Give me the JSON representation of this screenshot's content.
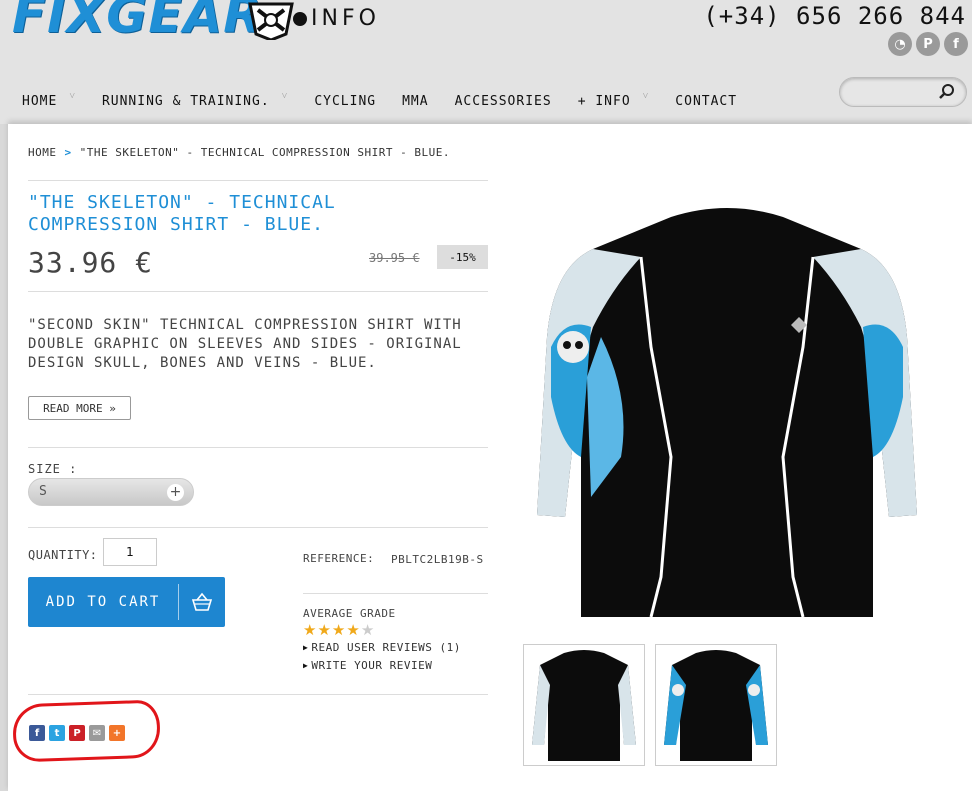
{
  "header": {
    "logo_text": "FIXGEAR",
    "logo_suffix": "INFO",
    "phone": "(+34) 656 266 844",
    "social": [
      {
        "icon": "rss-icon",
        "glyph": "◔"
      },
      {
        "icon": "pinterest-icon",
        "glyph": "P"
      },
      {
        "icon": "facebook-icon",
        "glyph": "f"
      }
    ]
  },
  "nav": {
    "items": [
      {
        "label": "Home",
        "dropdown": true
      },
      {
        "label": "Running & Training.",
        "dropdown": true
      },
      {
        "label": "Cycling",
        "dropdown": false
      },
      {
        "label": "MMA",
        "dropdown": false
      },
      {
        "label": "Accessories",
        "dropdown": false
      },
      {
        "label": "+ Info",
        "dropdown": true
      },
      {
        "label": "Contact",
        "dropdown": false
      }
    ],
    "search_placeholder": ""
  },
  "breadcrumb": {
    "home": "Home",
    "separator": ">",
    "current": "\"The Skeleton\" - Technical compression shirt - Blue."
  },
  "product": {
    "title": "\"The Skeleton\" - Technical compression shirt - Blue.",
    "price": "33.96 €",
    "old_price": "39.95 €",
    "discount": "-15%",
    "description": "\"Second skin\" technical compression shirt with double graphic on sleeves and sides - original design skull, bones and veins - Blue.",
    "read_more": "Read more »",
    "size_label": "Size :",
    "size_value": "S",
    "quantity_label": "Quantity:",
    "quantity_value": "1",
    "add_to_cart": "Add to cart",
    "reference_label": "Reference:",
    "reference_value": "PBLTC2LB19B-S",
    "average_grade_label": "Average grade",
    "rating": 4,
    "rating_max": 5,
    "read_reviews": "Read user reviews (1)",
    "write_review": "Write your review"
  },
  "share": [
    {
      "icon": "facebook-share-icon",
      "glyph": "f",
      "color": "#3b5998"
    },
    {
      "icon": "twitter-share-icon",
      "glyph": "t",
      "color": "#2ba3e1"
    },
    {
      "icon": "pinterest-share-icon",
      "glyph": "P",
      "color": "#cb2027"
    },
    {
      "icon": "email-share-icon",
      "glyph": "✉",
      "color": "#9a9a9a"
    },
    {
      "icon": "more-share-icon",
      "glyph": "+",
      "color": "#f2752a"
    }
  ],
  "colors": {
    "accent": "#1f8fd6",
    "cart_button": "#1e86d0",
    "star": "#f0a91b",
    "annotation": "#e1151a"
  }
}
